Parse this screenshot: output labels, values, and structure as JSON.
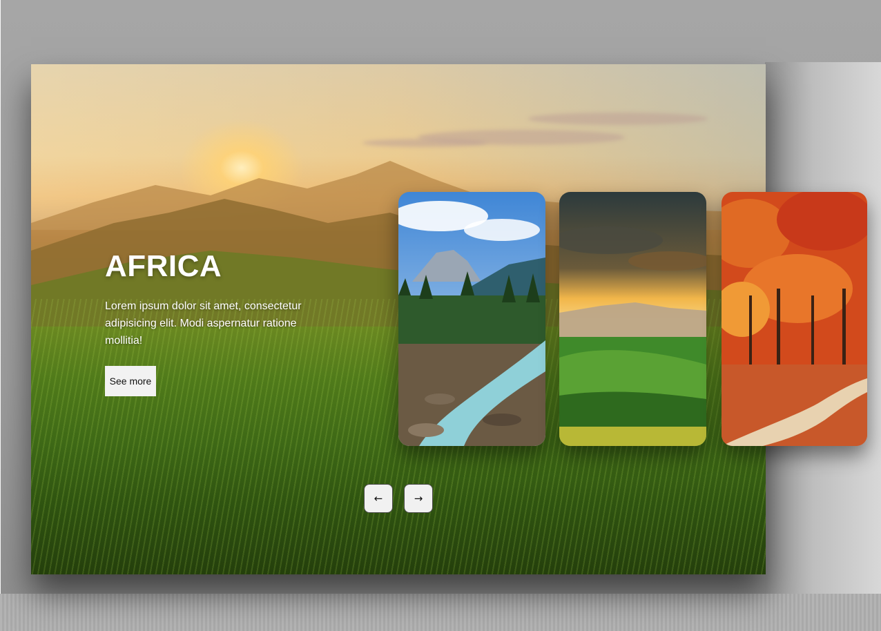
{
  "hero": {
    "title": "AFRICA",
    "description": "Lorem ipsum dolor sit amet, consectetur adipisicing elit. Modi aspernatur ratione mollitia!",
    "button_label": "See more"
  },
  "cards": [
    {
      "name": "mountain-river",
      "icon": "image"
    },
    {
      "name": "sunset-valley",
      "icon": "image"
    },
    {
      "name": "autumn-forest",
      "icon": "image"
    }
  ],
  "navigation": {
    "prev_icon": "←",
    "next_icon": "→"
  },
  "colors": {
    "button_bg": "#f2f2f2",
    "title_text": "#ffffff",
    "page_bg": "#a6a6a6"
  }
}
